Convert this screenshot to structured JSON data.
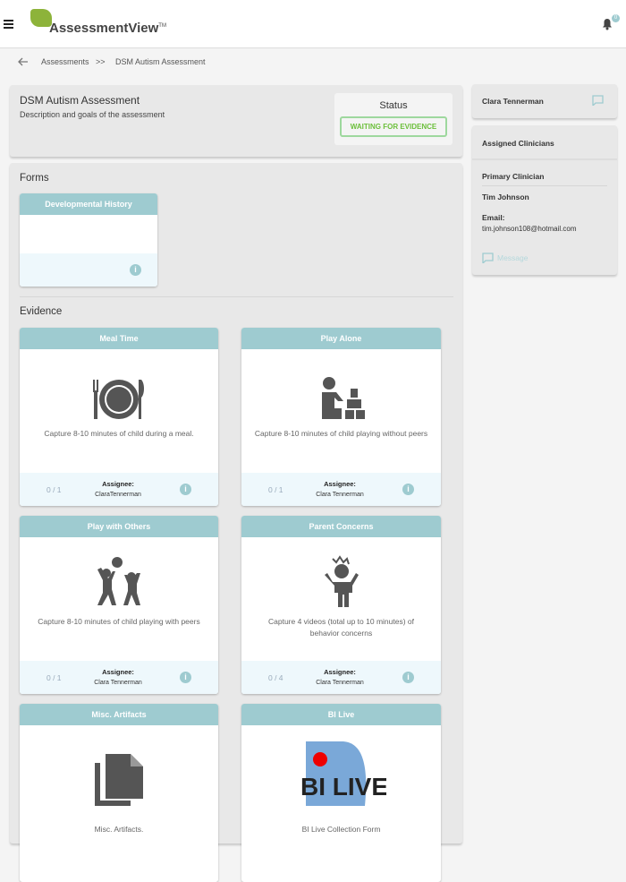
{
  "header": {
    "app_name": "AssessmentView",
    "trademark": "TM",
    "notification_count": "0"
  },
  "breadcrumb": {
    "parent": "Assessments",
    "separator": ">>",
    "current": "DSM Autism Assessment"
  },
  "assessment": {
    "title": "DSM Autism Assessment",
    "description": "Description and goals of the assessment",
    "status_label": "Status",
    "status": "WAITING FOR EVIDENCE"
  },
  "forms": {
    "label": "Forms",
    "items": [
      {
        "title": "Developmental History"
      }
    ]
  },
  "evidence": {
    "label": "Evidence",
    "assignee_label": "Assignee:",
    "items": [
      {
        "title": "Meal Time",
        "icon": "plate-icon",
        "description": "Capture 8-10 minutes of child during a meal.",
        "count": "0 / 1",
        "assignee": "ClaraTennerman"
      },
      {
        "title": "Play Alone",
        "icon": "child-blocks-icon",
        "description": "Capture 8-10 minutes of child playing without peers",
        "count": "0 / 1",
        "assignee": "Clara Tennerman"
      },
      {
        "title": "Play with Others",
        "icon": "children-ball-icon",
        "description": "Capture 8-10 minutes of child playing with peers",
        "count": "0 / 1",
        "assignee": "Clara Tennerman"
      },
      {
        "title": "Parent Concerns",
        "icon": "upset-child-icon",
        "description": "Capture 4 videos (total up to 10 minutes) of behavior concerns",
        "count": "0 / 4",
        "assignee": "Clara Tennerman"
      },
      {
        "title": "Misc. Artifacts",
        "icon": "documents-icon",
        "description": "Misc. Artifacts."
      },
      {
        "title": "BI Live",
        "icon": "bi-live-logo",
        "logo_text": "BI LIVE",
        "description": "BI Live Collection Form"
      }
    ]
  },
  "sidebar": {
    "patient": "Clara Tennerman",
    "assigned_label": "Assigned Clinicians",
    "primary_label": "Primary Clinician",
    "clinician": "Tim Johnson",
    "email_label": "Email:",
    "email": "tim.johnson108@hotmail.com",
    "message_label": "Message"
  },
  "colors": {
    "accent": "#9ecbd0",
    "status": "#6bbf3a",
    "footer": "#eef8fc"
  }
}
